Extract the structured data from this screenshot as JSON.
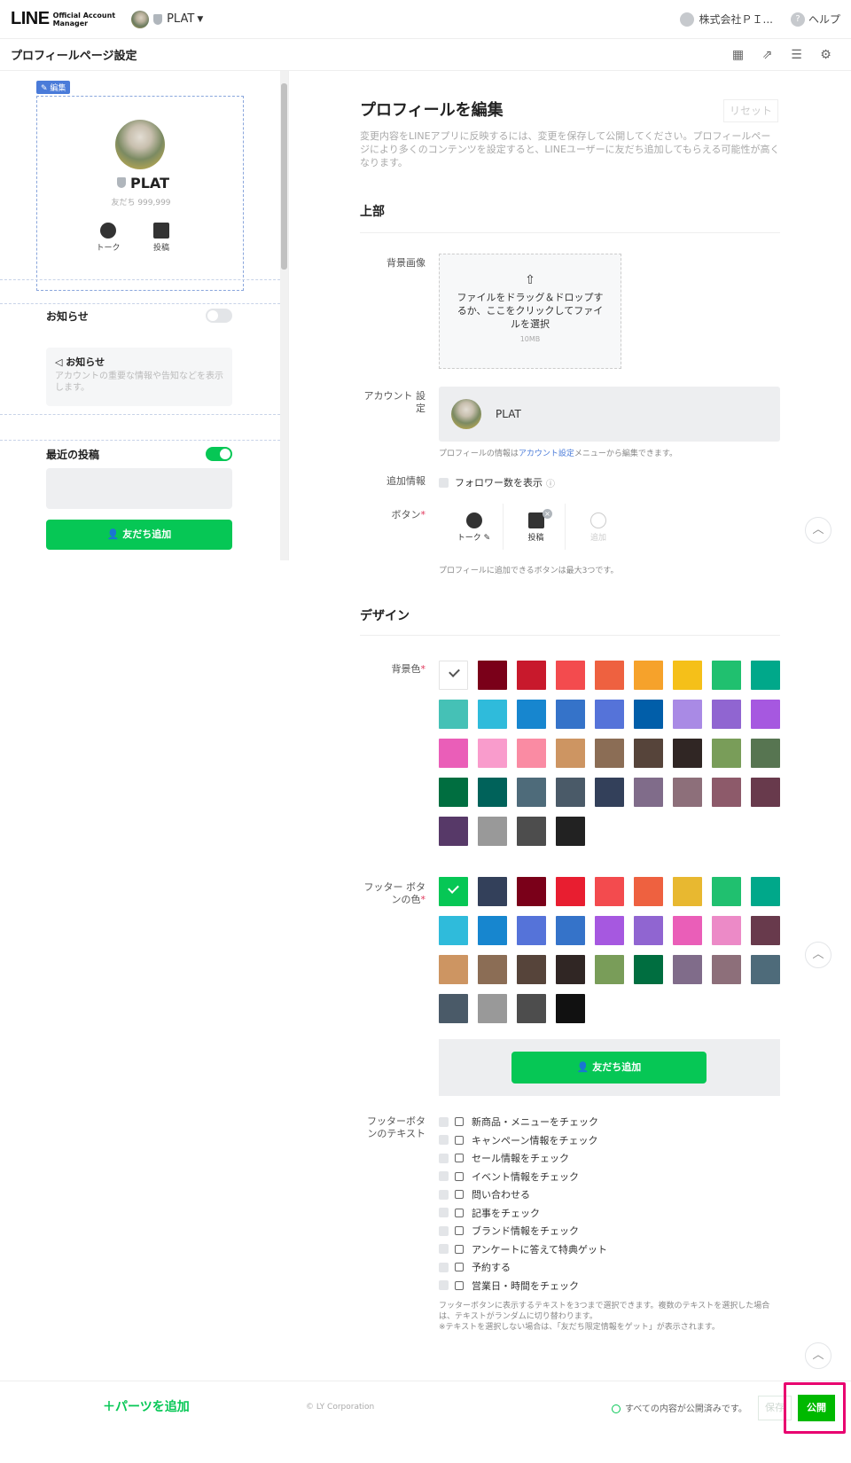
{
  "header": {
    "logo": "LINE",
    "logo_sub1": "Official Account",
    "logo_sub2": "Manager",
    "account_name": "PLAT",
    "user_name": "株式会社ＰＩ...",
    "help": "ヘルプ"
  },
  "page": {
    "title": "プロフィールページ設定"
  },
  "preview": {
    "edit_tag": "編集",
    "name": "PLAT",
    "friends": "友だち 999,999",
    "buttons": [
      "トーク",
      "投稿"
    ],
    "notice_section": "お知らせ",
    "notice_title": "お知らせ",
    "notice_desc": "アカウントの重要な情報や告知などを表示します。",
    "recent_posts": "最近の投稿",
    "add_friend": "友だち追加"
  },
  "editor": {
    "title": "プロフィールを編集",
    "reset": "リセット",
    "description": "変更内容をLINEアプリに反映するには、変更を保存して公開してください。プロフィールページにより多くのコンテンツを設定すると、LINEユーザーに友だち追加してもらえる可能性が高くなります。",
    "top_section": "上部",
    "bg_image_label": "背景画像",
    "upload_text": "ファイルをドラッグ＆ドロップするか、ここをクリックしてファイルを選択",
    "upload_size": "10MB",
    "account_label": "アカウント 設定",
    "account_name": "PLAT",
    "account_note_pre": "プロフィールの情報は",
    "account_note_link": "アカウント設定",
    "account_note_post": "メニューから編集できます。",
    "extra_label": "追加情報",
    "follower_label": "フォロワー数を表示",
    "buttons_label": "ボタン",
    "button_cells": [
      "トーク",
      "投稿",
      "追加"
    ],
    "buttons_note": "プロフィールに追加できるボタンは最大3つです。",
    "design_section": "デザイン",
    "bg_color_label": "背景色",
    "bg_colors": [
      "#ffffff",
      "#7a0019",
      "#c8192c",
      "#f34b4e",
      "#ee6140",
      "#f6a22b",
      "#f5c019",
      "#20c06f",
      "#00a88a",
      "#45c1b6",
      "#2fbbdb",
      "#1786cf",
      "#3573c9",
      "#5573d9",
      "#015ea9",
      "#a98ae5",
      "#9065d1",
      "#a658e0",
      "#ea5eb8",
      "#f99ccc",
      "#fa8ba3",
      "#cd9562",
      "#8b6d55",
      "#56443a",
      "#302624",
      "#799d59",
      "#577551",
      "#006e40",
      "#00625a",
      "#4e6b7a",
      "#4a5a68",
      "#33405a",
      "#806c8a",
      "#8d6f7a",
      "#8d5a6a",
      "#683a4c",
      "#573968",
      "#999999",
      "#4d4d4d",
      "#222222"
    ],
    "footer_color_label": "フッター ボタンの色",
    "footer_colors": [
      "#06c755",
      "#33405a",
      "#7a0019",
      "#e81e30",
      "#f34b4e",
      "#ee6140",
      "#e8b830",
      "#20c06f",
      "#00a88a",
      "#2fbbdb",
      "#1786cf",
      "#5573d9",
      "#3573c9",
      "#a658e0",
      "#9065d1",
      "#ea5eb8",
      "#ec8ac7",
      "#683a4c",
      "#cd9562",
      "#8b6d55",
      "#56443a",
      "#302624",
      "#799d59",
      "#006e40",
      "#806c8a",
      "#8d6f7a",
      "#4e6b7a",
      "#4a5a68",
      "#999999",
      "#4d4d4d",
      "#111111"
    ],
    "footer_preview_btn": "友だち追加",
    "footer_text_label": "フッターボタンのテキスト",
    "footer_texts": [
      "新商品・メニューをチェック",
      "キャンペーン情報をチェック",
      "セール情報をチェック",
      "イベント情報をチェック",
      "問い合わせる",
      "記事をチェック",
      "ブランド情報をチェック",
      "アンケートに答えて特典ゲット",
      "予約する",
      "営業日・時間をチェック"
    ],
    "footer_note1": "フッターボタンに表示するテキストを3つまで選択できます。複数のテキストを選択した場合は、テキストがランダムに切り替わります。",
    "footer_note2": "※テキストを選択しない場合は、「友だち限定情報をゲット」が表示されます。"
  },
  "bottom": {
    "add_parts": "＋パーツを追加",
    "copyright": "© LY Corporation",
    "status": "すべての内容が公開済みです。",
    "save": "保存",
    "publish": "公開"
  }
}
